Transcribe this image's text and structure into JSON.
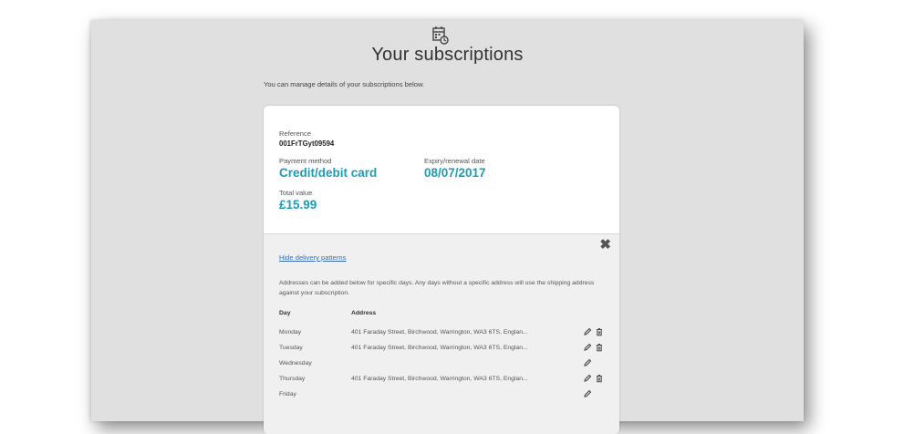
{
  "header": {
    "icon": "subscription-calendar-icon",
    "title": "Your subscriptions"
  },
  "intro": "You can manage details of your subscriptions below.",
  "subscription": {
    "reference_label": "Reference",
    "reference": "001FrTGyt09594",
    "payment_label": "Payment method",
    "payment": "Credit/debit card",
    "expiry_label": "Expiry/renewal date",
    "expiry": "08/07/2017",
    "total_label": "Total value",
    "total": "£15.99"
  },
  "delivery": {
    "hide_link": "Hide delivery patterns",
    "note": "Addresses can be added below for specific days. Any days without a specific address will use the shipping address against your subscription.",
    "columns": {
      "day": "Day",
      "address": "Address"
    },
    "rows": [
      {
        "day": "Monday",
        "address": "401 Faraday Street, Birchwood, Warrington, WA3 6TS, Englan..."
      },
      {
        "day": "Tuesday",
        "address": "401 Faraday Street, Birchwood, Warrington, WA3 6TS, Englan..."
      },
      {
        "day": "Wednesday",
        "address": ""
      },
      {
        "day": "Thursday",
        "address": "401 Faraday Street, Birchwood, Warrington, WA3 6TS, Englan..."
      },
      {
        "day": "Friday",
        "address": ""
      }
    ]
  },
  "colors": {
    "accent": "#1f9bb6",
    "link": "#3a6fb5",
    "panel": "#e0e0e0"
  }
}
